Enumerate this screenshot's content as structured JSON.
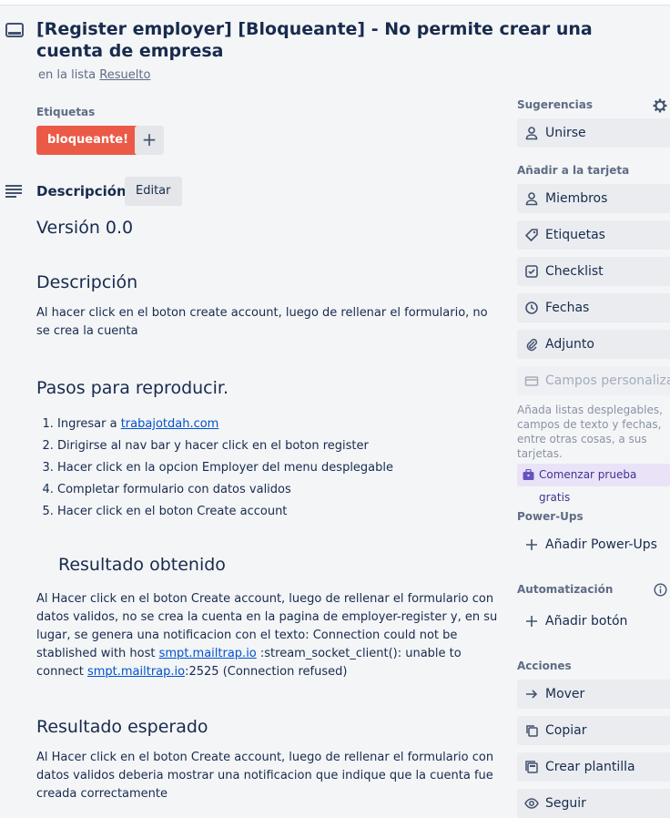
{
  "card": {
    "title": "[Register employer] [Bloqueante] - No permite crear una cuenta de empresa",
    "in_list_prefix": "en la lista",
    "list_name": "Resuelto"
  },
  "labels": {
    "heading": "Etiquetas",
    "items": [
      {
        "text": "bloqueante!",
        "color": "#eb5a46"
      }
    ],
    "add_symbol": "+"
  },
  "description": {
    "heading": "Descripción",
    "edit_label": "Editar",
    "version": "Versión 0.0",
    "desc_heading": "Descripción",
    "desc_text": "Al hacer click en el boton create account, luego de rellenar el formulario, no se crea la cuenta",
    "steps_heading": "Pasos para reproducir.",
    "steps": [
      {
        "prefix": "Ingresar a ",
        "link": "trabajotdah.com"
      },
      {
        "prefix": "Dirigirse al nav bar y hacer click en el boton register",
        "link": ""
      },
      {
        "prefix": "Hacer click en la opcion Employer del menu desplegable",
        "link": ""
      },
      {
        "prefix": "Completar formulario con datos validos",
        "link": ""
      },
      {
        "prefix": "Hacer click en el boton Create account",
        "link": ""
      }
    ],
    "obtained_heading": "Resultado obtenido",
    "obtained_text_1": "Al Hacer click en el boton Create account, luego de rellenar el formulario con datos validos, no se crea la cuenta en la pagina de employer-register y, en su lugar, se genera una notificacion con el texto: Connection could not be stablished with host ",
    "obtained_link_1": "smpt.mailtrap.io",
    "obtained_text_2": " :stream_socket_client(): unable to connect ",
    "obtained_link_2": "smpt.mailtrap.io",
    "obtained_text_3": ":2525 (Connection refused)",
    "expected_heading": "Resultado esperado",
    "expected_text": "Al Hacer click en el boton Create account, luego de rellenar el formulario con datos validos deberia mostrar una notificacion que indique que la cuenta fue creada correctamente"
  },
  "sidebar": {
    "suggestions_heading": "Sugerencias",
    "join_label": "Unirse",
    "add_heading": "Añadir a la tarjeta",
    "members_label": "Miembros",
    "labels_label": "Etiquetas",
    "checklist_label": "Checklist",
    "dates_label": "Fechas",
    "attachment_label": "Adjunto",
    "custom_fields_label": "Campos personalizados",
    "custom_fields_hint": "Añada listas desplegables, campos de texto y fechas, entre otras cosas, a sus tarjetas.",
    "trial_label": "Comenzar prueba gratis",
    "powerups_heading": "Power-Ups",
    "add_powerups_label": "Añadir Power-Ups",
    "automation_heading": "Automatización",
    "add_button_label": "Añadir botón",
    "actions_heading": "Acciones",
    "move_label": "Mover",
    "copy_label": "Copiar",
    "template_label": "Crear plantilla",
    "follow_label": "Seguir"
  }
}
